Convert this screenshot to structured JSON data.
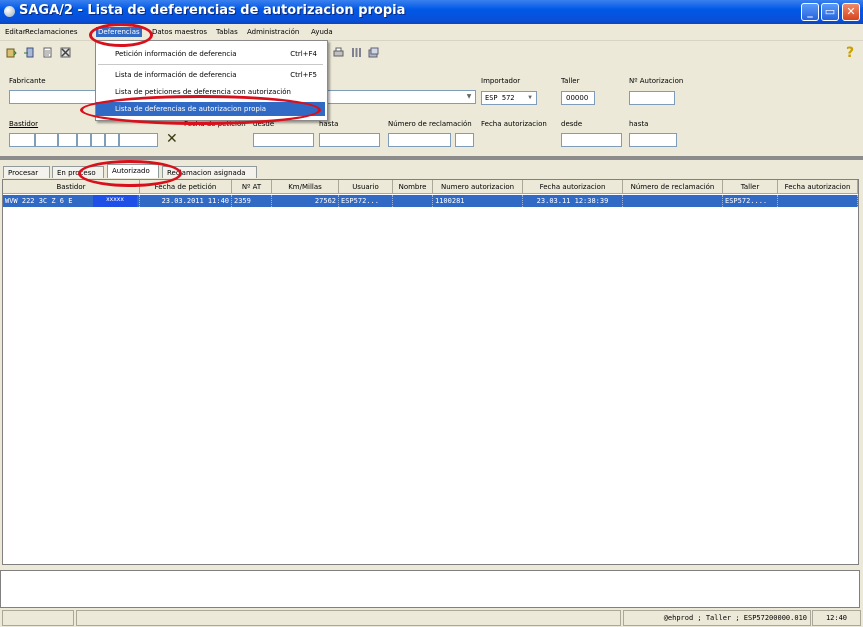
{
  "window": {
    "title": "SAGA/2 - Lista de deferencias de autorizacion propia",
    "minimize": "_",
    "maximize": "▭",
    "close": "✕"
  },
  "menubar": [
    "Editar",
    "Reclamaciones",
    "Deferencias",
    "Datos maestros",
    "Tablas",
    "Administración",
    "Ayuda"
  ],
  "dropdown": {
    "items": [
      {
        "label": "Petición información de deferencia",
        "shortcut": "Ctrl+F4"
      },
      {
        "label": "Lista de información de deferencia",
        "shortcut": "Ctrl+F5"
      },
      {
        "label": "Lista de peticiones de deferencia con autorización",
        "shortcut": ""
      },
      {
        "label": "Lista de deferencias de autorizacion propia",
        "shortcut": ""
      }
    ]
  },
  "help": "?",
  "form": {
    "fabricante_label": "Fabricante",
    "importador_label": "Importador",
    "importador_value": "ESP 572",
    "taller_label": "Taller",
    "taller_value": "00000",
    "nautorizacion_label": "Nº Autorizacion",
    "bastidor_label": "Bastidor",
    "fecha_peticion_label": "Fecha de petición",
    "desde_label": "desde",
    "hasta_label": "hasta",
    "num_reclamacion_label": "Número de reclamación",
    "fecha_autorizacion_label": "Fecha autorizacion",
    "desde2_label": "desde",
    "hasta2_label": "hasta",
    "clear_icon": "✕"
  },
  "tabs": [
    "Procesar",
    "En proceso",
    "Autorizado",
    "Reclamacion asignada"
  ],
  "table": {
    "columns": [
      "Bastidor",
      "Fecha de petición",
      "Nº AT",
      "Km/Millas",
      "Usuario",
      "Nombre",
      "Numero autorizacion",
      "Fecha autorizacion",
      "Número de reclamación",
      "Taller",
      "Fecha autorizacion"
    ],
    "rows": [
      [
        "WVW 222 3C Z 6 E ",
        "23.03.2011 11:40",
        "2359",
        "27562",
        "ESP572...",
        "",
        "1100281",
        "23.03.11 12:38:39",
        "",
        "ESP572....",
        ""
      ]
    ],
    "masked_text": "xxxxx"
  },
  "status": {
    "segment1": "",
    "segment2": "",
    "info": "@ehprod ; Taller ; ESP57200000.010",
    "time": "12:40"
  },
  "colors": {
    "titlebar": "#0058e6",
    "selection": "#316ac5",
    "highlight_ring": "#d8101c"
  }
}
